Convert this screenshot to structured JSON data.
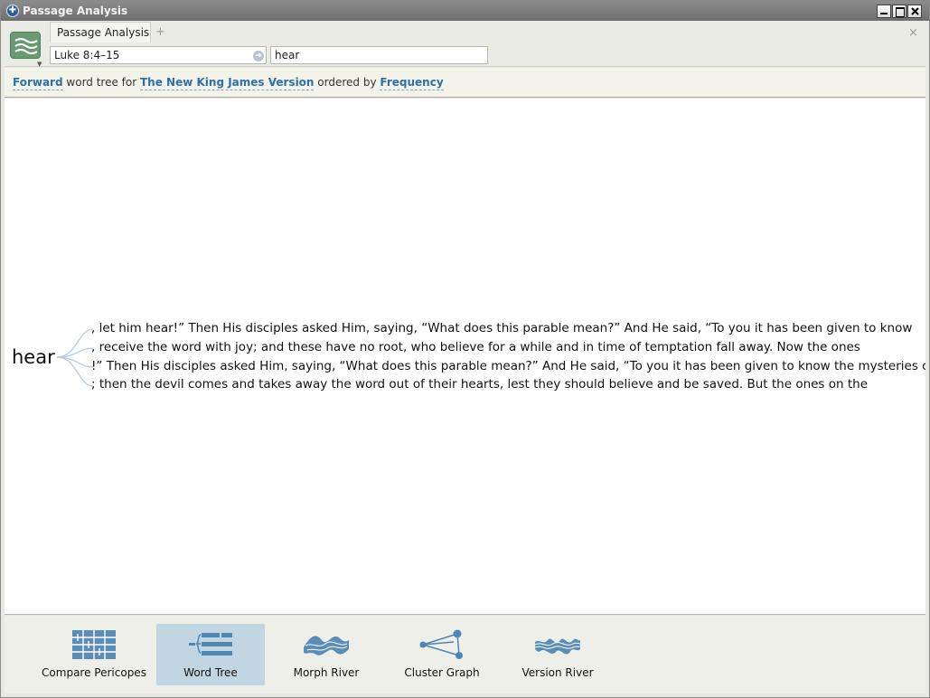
{
  "window": {
    "title": "Passage Analysis"
  },
  "header": {
    "tab_label": "Passage Analysis",
    "add_tab": "+",
    "close": "×",
    "reference_value": "Luke 8:4–15",
    "search_value": "hear"
  },
  "options": {
    "direction": "Forward",
    "text1": "word tree for",
    "version": "The New King James Version",
    "text2": "ordered by",
    "order": "Frequency"
  },
  "word_tree": {
    "root": "hear",
    "branches": [
      ", let him hear!”  Then His disciples asked Him, saying, “What does this parable mean?”  And He said,  “To you it has been given to know",
      ", receive the word with joy; and these have no root, who believe for a while and in time of temptation fall away. Now the ones",
      "!”  Then His disciples asked Him, saying, “What does this parable mean?”  And He said,  “To you it has been given to know the mysteries of",
      "; then the devil comes and takes away the word out of their hearts, lest they should believe and be saved. But the ones on the"
    ]
  },
  "tools": [
    {
      "label": "Compare Pericopes",
      "icon": "compare-pericopes-icon",
      "active": false
    },
    {
      "label": "Word Tree",
      "icon": "word-tree-icon",
      "active": true
    },
    {
      "label": "Morph River",
      "icon": "morph-river-icon",
      "active": false
    },
    {
      "label": "Cluster Graph",
      "icon": "cluster-graph-icon",
      "active": false
    },
    {
      "label": "Version River",
      "icon": "version-river-icon",
      "active": false
    }
  ],
  "colors": {
    "accent": "#2f6fa8",
    "active_tool": "#c2d5e3",
    "icon": "#4f86b3"
  }
}
